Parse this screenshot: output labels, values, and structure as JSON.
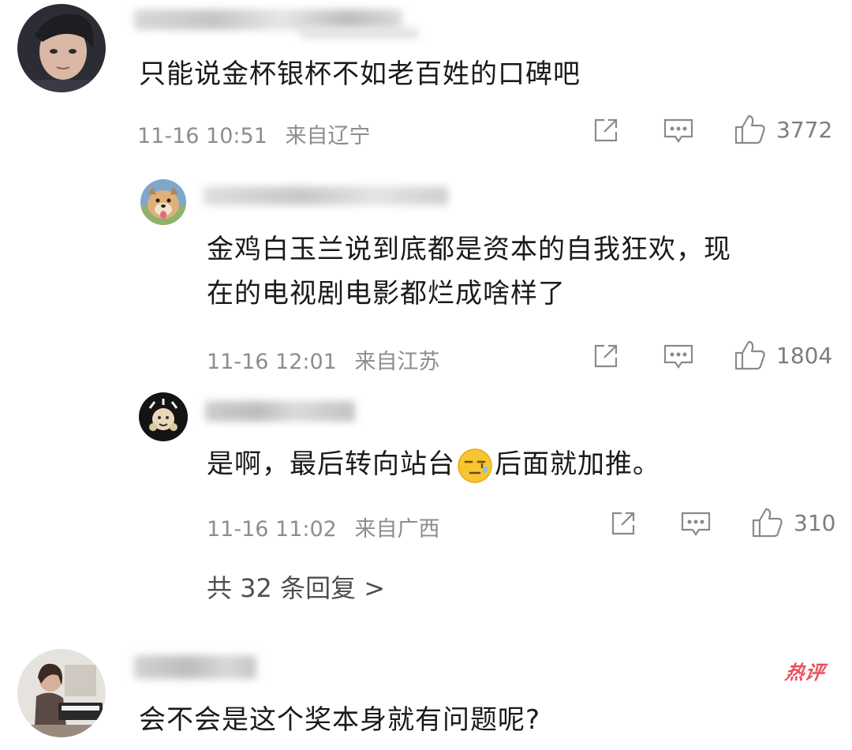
{
  "comments": [
    {
      "text": "只能说金杯银杯不如老百姓的口碑吧",
      "date": "11-16 10:51",
      "location": "来自辽宁",
      "likes": "3772"
    },
    {
      "text_line1": "金鸡白玉兰说到底都是资本的自我狂欢，现",
      "text_line2": "在的电视剧电影都烂成啥样了",
      "date": "11-16 12:01",
      "location": "来自江苏",
      "likes": "1804"
    },
    {
      "text_before": "是啊，最后转向站台",
      "text_after": "后面就加推。",
      "date": "11-16 11:02",
      "location": "来自广西",
      "likes": "310"
    },
    {
      "text": "会不会是这个奖本身就有问题呢?",
      "badge": "热评"
    }
  ],
  "replies_link": "共 32 条回复 >",
  "icons": {
    "share": "share-icon",
    "comment": "comment-icon",
    "like": "thumbs-up-icon",
    "emoji": "awkward-face-emoji-icon"
  }
}
